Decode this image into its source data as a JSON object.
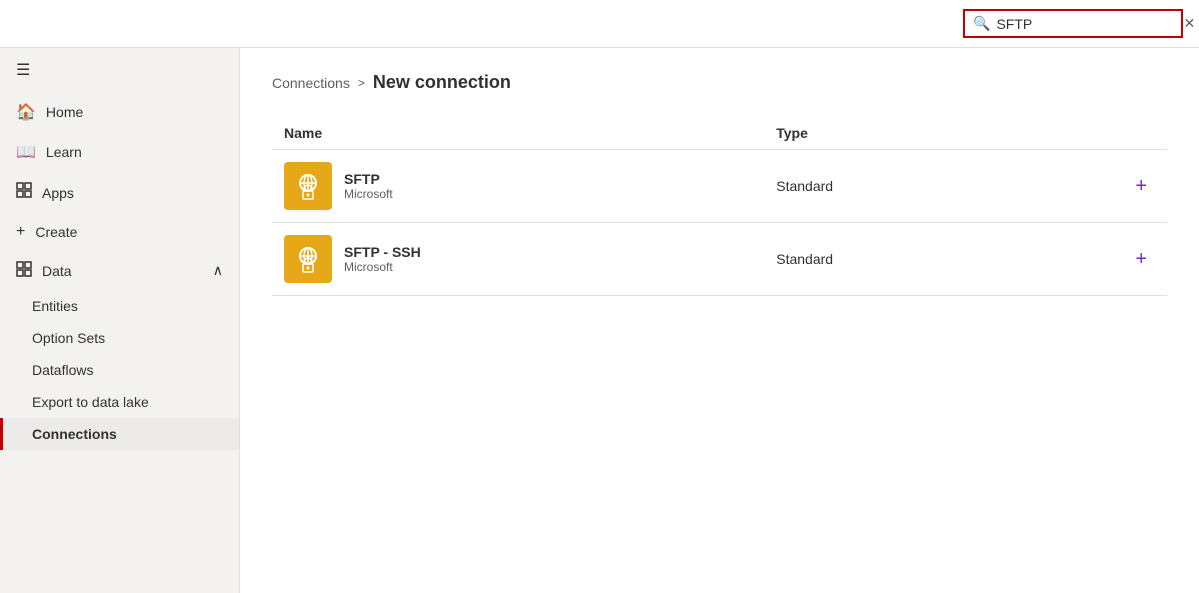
{
  "topbar": {
    "search_value": "SFTP",
    "search_placeholder": "Search"
  },
  "sidebar": {
    "hamburger_label": "☰",
    "items": [
      {
        "id": "home",
        "label": "Home",
        "icon": "🏠"
      },
      {
        "id": "learn",
        "label": "Learn",
        "icon": "📖"
      },
      {
        "id": "apps",
        "label": "Apps",
        "icon": "⊞"
      },
      {
        "id": "create",
        "label": "Create",
        "icon": "+"
      }
    ],
    "data_section": {
      "label": "Data",
      "chevron": "∧",
      "sub_items": [
        {
          "id": "entities",
          "label": "Entities",
          "active": false
        },
        {
          "id": "option-sets",
          "label": "Option Sets",
          "active": false
        },
        {
          "id": "dataflows",
          "label": "Dataflows",
          "active": false
        },
        {
          "id": "export",
          "label": "Export to data lake",
          "active": false
        },
        {
          "id": "connections",
          "label": "Connections",
          "active": true
        }
      ]
    }
  },
  "breadcrumb": {
    "parent": "Connections",
    "separator": ">",
    "current": "New connection"
  },
  "table": {
    "columns": [
      {
        "id": "name",
        "label": "Name"
      },
      {
        "id": "type",
        "label": "Type"
      }
    ],
    "rows": [
      {
        "id": "sftp",
        "name": "SFTP",
        "publisher": "Microsoft",
        "type": "Standard",
        "add_label": "+"
      },
      {
        "id": "sftp-ssh",
        "name": "SFTP - SSH",
        "publisher": "Microsoft",
        "type": "Standard",
        "add_label": "+"
      }
    ]
  },
  "icons": {
    "search": "🔍",
    "close": "✕",
    "hamburger": "≡",
    "home": "⌂",
    "book": "📖",
    "apps": "⊞",
    "plus": "+",
    "globe_lock": "globe-lock",
    "chevron_up": "∧"
  }
}
